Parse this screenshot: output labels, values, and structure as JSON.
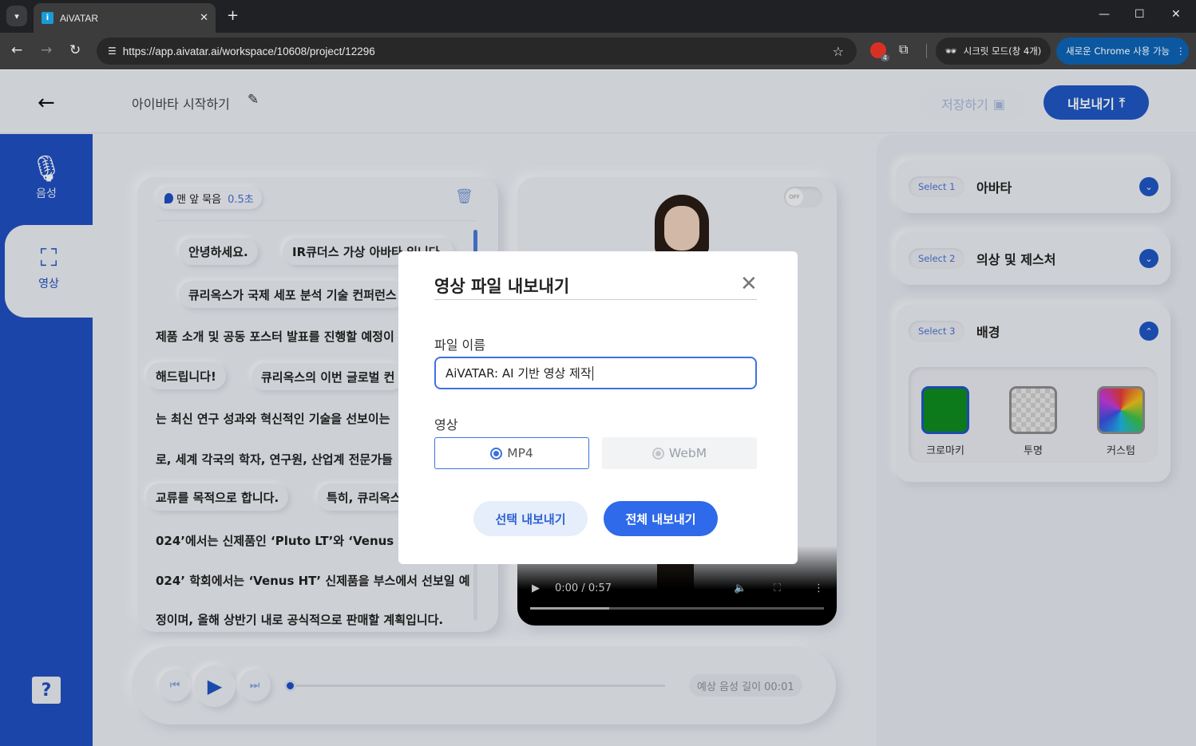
{
  "browser": {
    "tab_title": "AiVATAR",
    "favicon_letter": "i",
    "url": "https://app.aivatar.ai/workspace/10608/project/12296",
    "incognito_label": "시크릿 모드(창 4개)",
    "new_chrome_label": "새로운 Chrome 사용 가능",
    "ext_badge": "4"
  },
  "header": {
    "project_title": "아이바타 시작하기",
    "save_label": "저장하기",
    "export_label": "내보내기"
  },
  "sidebar": {
    "items": [
      {
        "label": "음성"
      },
      {
        "label": "영상"
      }
    ],
    "help_label": "?"
  },
  "script": {
    "pause_label": "맨 앞 묵음",
    "pause_value": "0.5초",
    "sentences": [
      "안녕하세요.",
      "IR큐더스 가상 아바타 입니다.",
      "큐리옥스가 국제 세포 분석 기술 컨퍼런스",
      "제품 소개 및 공동 포스터 발표를 진행할 예정이",
      "해드립니다!",
      "큐리옥스의 이번 글로벌 컨",
      "는 최신 연구 성과와 혁신적인 기술을 선보이는",
      "로, 세계 각국의 학자, 연구원, 산업계 전문가들",
      "교류를 목적으로 합니다.",
      "특히, 큐리옥스",
      "024’에서는 신제품인 ‘Pluto LT’와 ‘Venus H",
      "024’ 학회에서는 ‘Venus HT’ 신제품을 부스에서 선보일 예",
      "정이며, 올해 상반기 내로 공식적으로 판매할 계획입니다."
    ]
  },
  "video": {
    "toggle_label": "OFF",
    "time": "0:00 / 0:57",
    "progress_fraction": 0.27
  },
  "right_panel": {
    "sections": [
      {
        "chip": "Select 1",
        "name": "아바타",
        "expanded": false
      },
      {
        "chip": "Select 2",
        "name": "의상 및 제스처",
        "expanded": false
      },
      {
        "chip": "Select 3",
        "name": "배경",
        "expanded": true
      }
    ],
    "backgrounds": [
      {
        "label": "크로마키",
        "color": "#0e8a1e",
        "selected": true
      },
      {
        "label": "투명",
        "color": "#d8d8d8",
        "selected": false
      },
      {
        "label": "커스텀",
        "color": "rainbow",
        "selected": false
      }
    ]
  },
  "playbar": {
    "length_label": "예상 음성 길이 00:01"
  },
  "modal": {
    "title": "영상 파일 내보내기",
    "file_label": "파일 이름",
    "file_value": "AiVATAR: AI 기반 영상 제작",
    "format_label": "영상",
    "formats": [
      {
        "label": "MP4",
        "selected": true,
        "enabled": true
      },
      {
        "label": "WebM",
        "selected": false,
        "enabled": false
      }
    ],
    "select_export_label": "선택 내보내기",
    "all_export_label": "전체 내보내기"
  },
  "colors": {
    "brand_blue": "#1f4fc0",
    "accent_blue": "#2e6ae9"
  }
}
